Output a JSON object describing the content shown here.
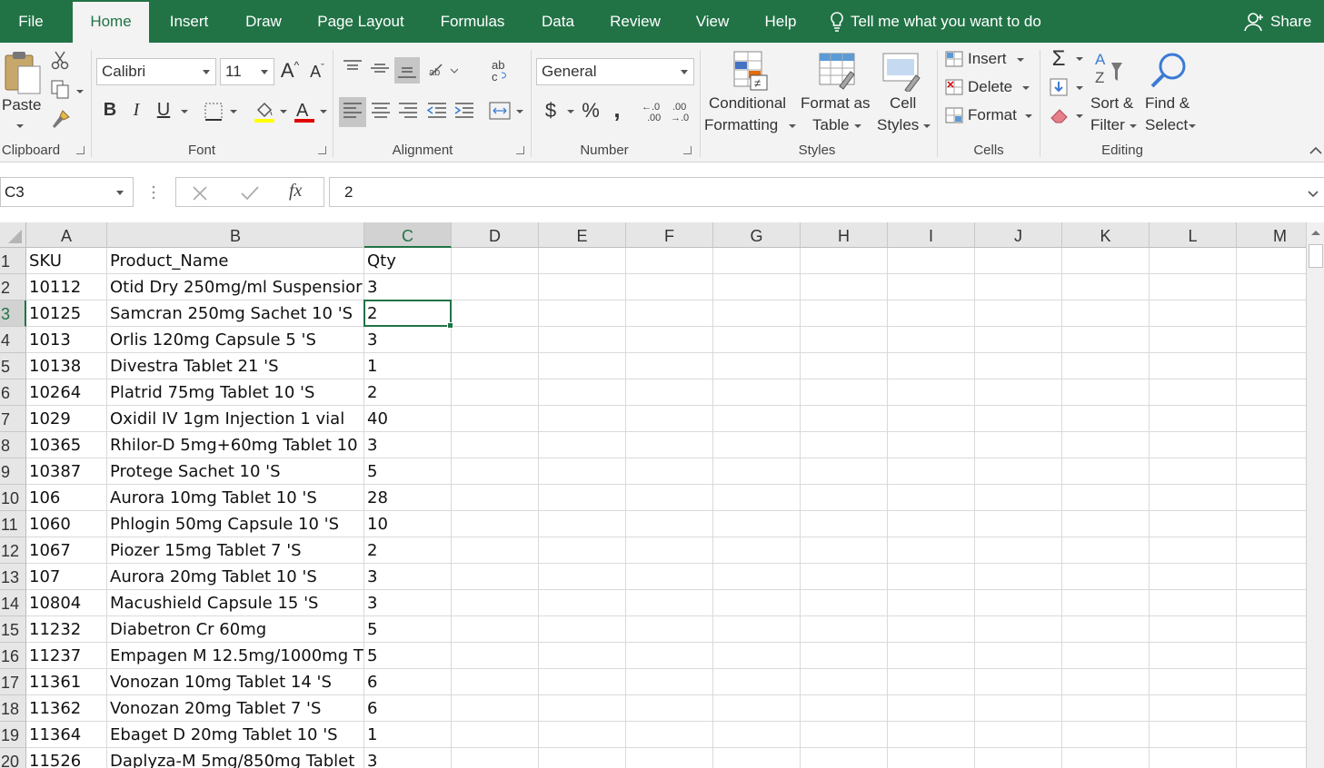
{
  "tabs": [
    {
      "label": "File"
    },
    {
      "label": "Home"
    },
    {
      "label": "Insert"
    },
    {
      "label": "Draw"
    },
    {
      "label": "Page Layout"
    },
    {
      "label": "Formulas"
    },
    {
      "label": "Data"
    },
    {
      "label": "Review"
    },
    {
      "label": "View"
    },
    {
      "label": "Help"
    }
  ],
  "tell_me": "Tell me what you want to do",
  "share": "Share",
  "ribbon": {
    "clipboard": {
      "paste": "Paste",
      "label": "Clipboard"
    },
    "font": {
      "name": "Calibri",
      "size": "11",
      "label": "Font"
    },
    "alignment": {
      "label": "Alignment"
    },
    "number": {
      "format": "General",
      "label": "Number",
      "currency": "$",
      "percent": "%",
      "comma": ","
    },
    "styles": {
      "conditional_1": "Conditional",
      "conditional_2": "Formatting",
      "format_table_1": "Format as",
      "format_table_2": "Table",
      "cell_styles_1": "Cell",
      "cell_styles_2": "Styles",
      "label": "Styles"
    },
    "cells": {
      "insert": "Insert",
      "delete": "Delete",
      "format": "Format",
      "label": "Cells"
    },
    "editing": {
      "sort_1": "Sort &",
      "sort_2": "Filter",
      "find_1": "Find &",
      "find_2": "Select",
      "label": "Editing"
    }
  },
  "formula_bar": {
    "name_box": "C3",
    "value": "2",
    "fx": "fx"
  },
  "columns": [
    "A",
    "B",
    "C",
    "D",
    "E",
    "F",
    "G",
    "H",
    "I",
    "J",
    "K",
    "L",
    "M"
  ],
  "selected": {
    "col": "C",
    "row": 3
  },
  "rows": [
    {
      "n": "1",
      "a": "SKU",
      "b": "Product_Name",
      "c": "Qty"
    },
    {
      "n": "2",
      "a": "10112",
      "b": "Otid Dry 250mg/ml Suspensior",
      "c": "3"
    },
    {
      "n": "3",
      "a": "10125",
      "b": "Samcran 250mg Sachet 10 'S",
      "c": "2"
    },
    {
      "n": "4",
      "a": "1013",
      "b": "Orlis 120mg Capsule 5 'S",
      "c": "3"
    },
    {
      "n": "5",
      "a": "10138",
      "b": "Divestra Tablet 21 'S",
      "c": "1"
    },
    {
      "n": "6",
      "a": "10264",
      "b": "Platrid 75mg Tablet 10 'S",
      "c": "2"
    },
    {
      "n": "7",
      "a": "1029",
      "b": "Oxidil IV 1gm Injection 1 vial",
      "c": "40"
    },
    {
      "n": "8",
      "a": "10365",
      "b": "Rhilor-D 5mg+60mg Tablet 10 '",
      "c": "3"
    },
    {
      "n": "9",
      "a": "10387",
      "b": "Protege Sachet 10 'S",
      "c": "5"
    },
    {
      "n": "10",
      "a": "106",
      "b": "Aurora 10mg Tablet 10 'S",
      "c": "28"
    },
    {
      "n": "11",
      "a": "1060",
      "b": "Phlogin 50mg Capsule 10 'S",
      "c": "10"
    },
    {
      "n": "12",
      "a": "1067",
      "b": "Piozer 15mg Tablet 7 'S",
      "c": "2"
    },
    {
      "n": "13",
      "a": "107",
      "b": "Aurora 20mg Tablet 10 'S",
      "c": "3"
    },
    {
      "n": "14",
      "a": "10804",
      "b": "Macushield Capsule 15 'S",
      "c": "3"
    },
    {
      "n": "15",
      "a": "11232",
      "b": "Diabetron Cr 60mg",
      "c": "5"
    },
    {
      "n": "16",
      "a": "11237",
      "b": "Empagen M 12.5mg/1000mg T",
      "c": "5"
    },
    {
      "n": "17",
      "a": "11361",
      "b": "Vonozan 10mg Tablet 14 'S",
      "c": "6"
    },
    {
      "n": "18",
      "a": "11362",
      "b": "Vonozan 20mg Tablet 7 'S",
      "c": "6"
    },
    {
      "n": "19",
      "a": "11364",
      "b": "Ebaget D 20mg Tablet 10 'S",
      "c": "1"
    },
    {
      "n": "20",
      "a": "11526",
      "b": "Daplyza-M 5mg/850mg Tablet",
      "c": "3"
    }
  ]
}
